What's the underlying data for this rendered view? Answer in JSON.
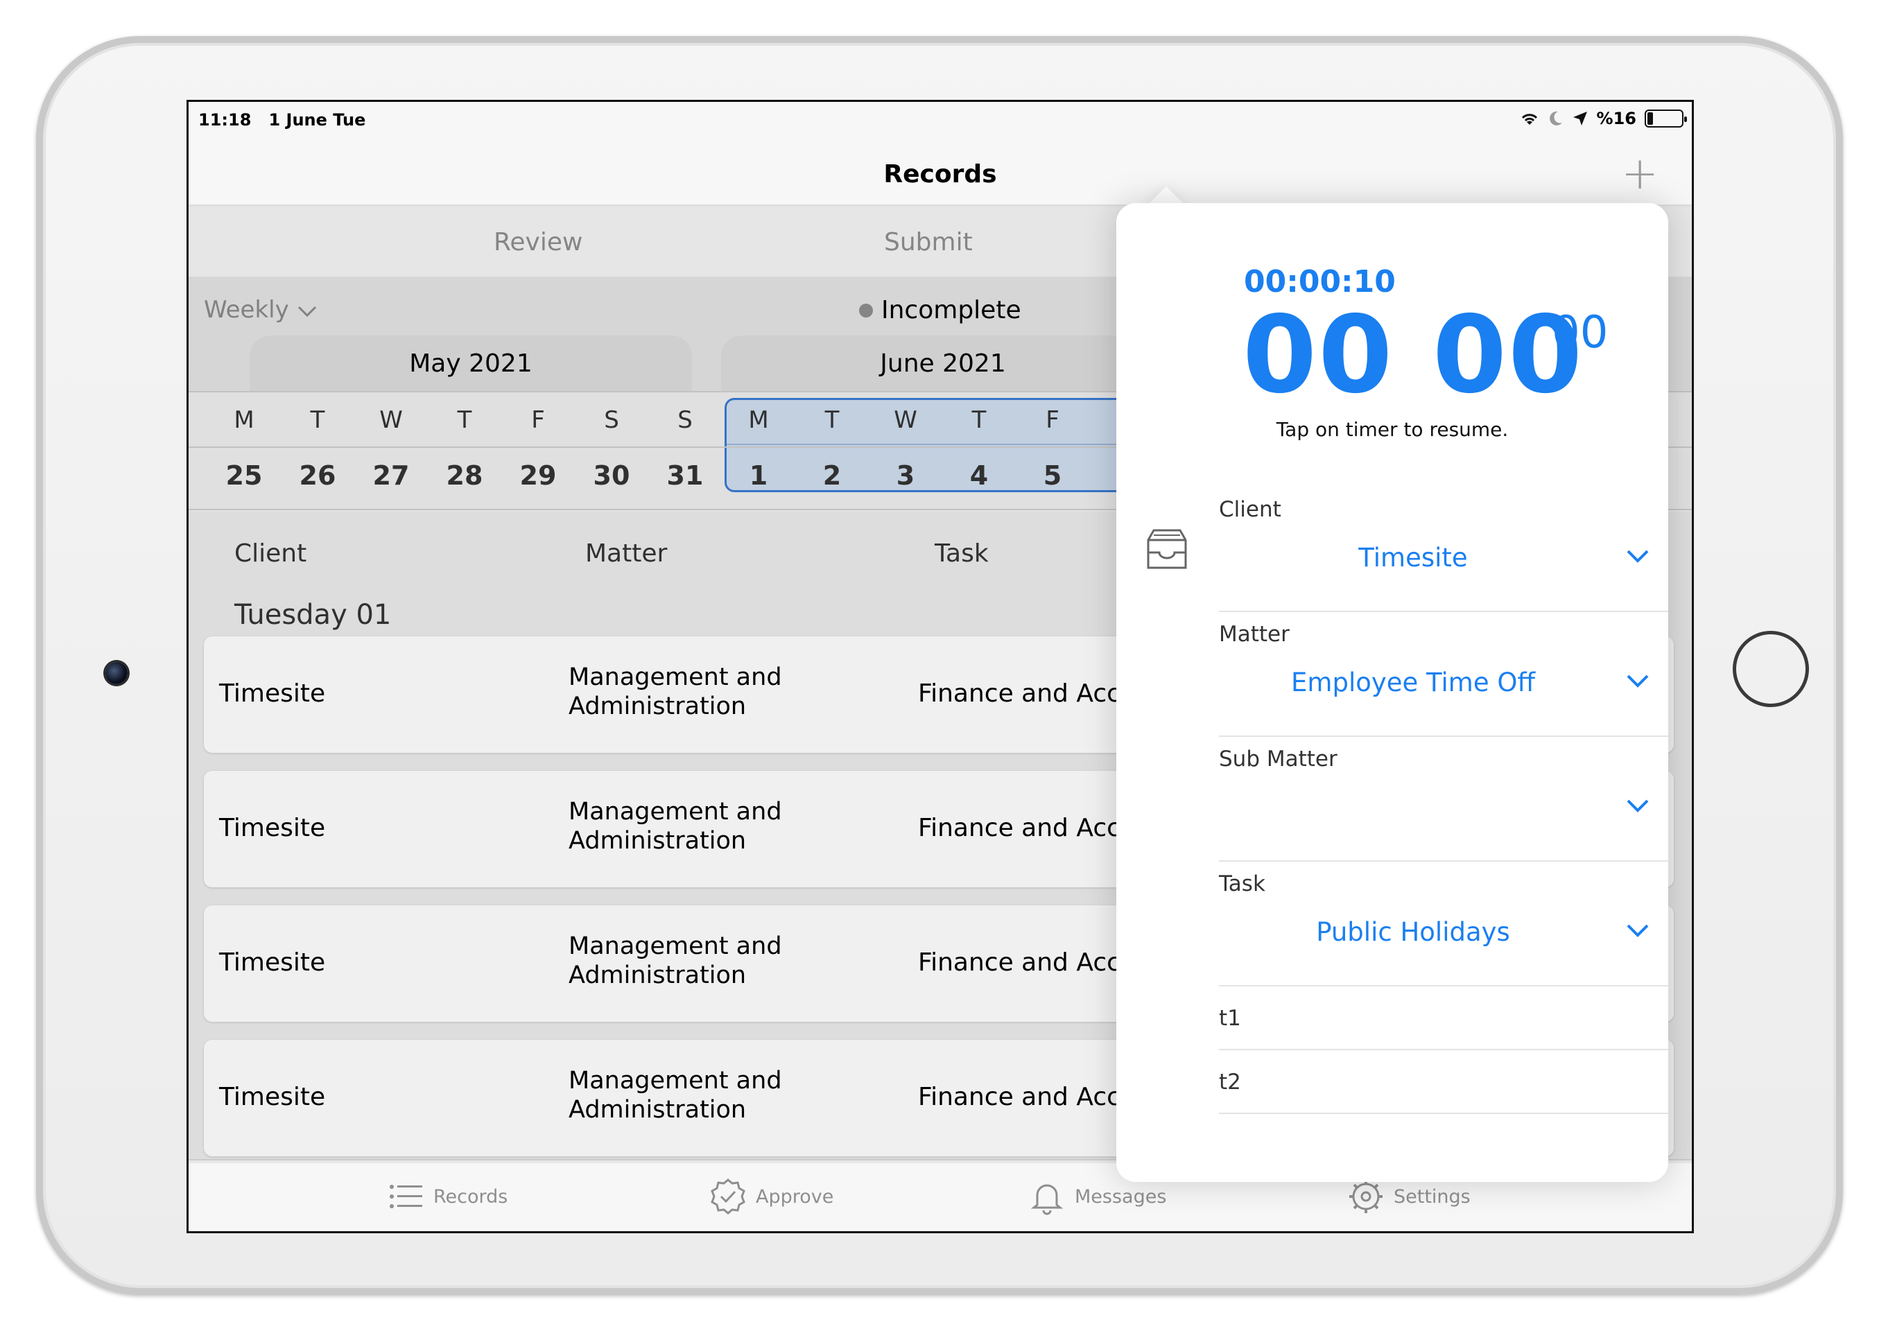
{
  "status": {
    "time": "11:18",
    "date": "1 June Tue",
    "battery": "%16"
  },
  "nav": {
    "title": "Records",
    "add_icon": "plus-icon"
  },
  "segments": {
    "review": "Review",
    "submit": "Submit"
  },
  "filter": {
    "period": "Weekly",
    "status": "Incomplete"
  },
  "months": [
    "May 2021",
    "June 2021"
  ],
  "days": [
    {
      "letter": "M",
      "num": "25"
    },
    {
      "letter": "T",
      "num": "26"
    },
    {
      "letter": "W",
      "num": "27"
    },
    {
      "letter": "T",
      "num": "28"
    },
    {
      "letter": "F",
      "num": "29"
    },
    {
      "letter": "S",
      "num": "30"
    },
    {
      "letter": "S",
      "num": "31"
    },
    {
      "letter": "M",
      "num": "1"
    },
    {
      "letter": "T",
      "num": "2"
    },
    {
      "letter": "W",
      "num": "3"
    },
    {
      "letter": "T",
      "num": "4"
    },
    {
      "letter": "F",
      "num": "5"
    }
  ],
  "columns": {
    "client": "Client",
    "matter": "Matter",
    "task": "Task"
  },
  "day_heading": "Tuesday 01",
  "rows": [
    {
      "client": "Timesite",
      "matter_line1": "Management and",
      "matter_line2": "Administration",
      "task": "Finance and Acco"
    },
    {
      "client": "Timesite",
      "matter_line1": "Management and",
      "matter_line2": "Administration",
      "task": "Finance and Acco"
    },
    {
      "client": "Timesite",
      "matter_line1": "Management and",
      "matter_line2": "Administration",
      "task": "Finance and Acco"
    },
    {
      "client": "Timesite",
      "matter_line1": "Management and",
      "matter_line2": "Administration",
      "task": "Finance and Acco"
    }
  ],
  "tabs": {
    "records": "Records",
    "approve": "Approve",
    "messages": "Messages",
    "settings": "Settings"
  },
  "timer": {
    "elapsed": "00:00:10",
    "big": "00 00",
    "sup": "00",
    "hint": "Tap on timer to resume."
  },
  "form": {
    "client": {
      "label": "Client",
      "value": "Timesite"
    },
    "matter": {
      "label": "Matter",
      "value": "Employee Time Off"
    },
    "sub_matter": {
      "label": "Sub Matter",
      "value": ""
    },
    "task": {
      "label": "Task",
      "value": "Public Holidays"
    },
    "t1": "t1",
    "t2": "t2"
  },
  "colors": {
    "accent": "#1a7ff0",
    "selection": "#3a7bd5"
  }
}
